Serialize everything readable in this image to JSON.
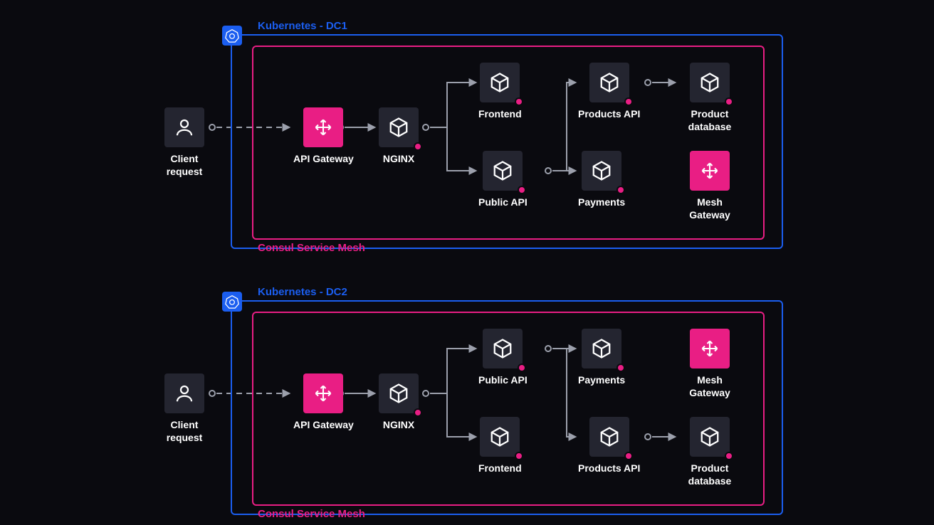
{
  "colors": {
    "background": "#0a0a0f",
    "cluster_border": "#1b5ef0",
    "mesh_border": "#e91e84",
    "node_bg": "#242530",
    "gateway_bg": "#e91e84",
    "text": "#ffffff"
  },
  "clients": [
    {
      "label": "Client request"
    },
    {
      "label": "Client request"
    }
  ],
  "clusters": [
    {
      "title": "Kubernetes - DC1",
      "mesh_title": "Consul Service Mesh",
      "nodes": {
        "api_gateway": {
          "label": "API Gateway",
          "icon": "move",
          "pink": true
        },
        "nginx": {
          "label": "NGINX",
          "icon": "cube",
          "dot": true
        },
        "frontend": {
          "label": "Frontend",
          "icon": "cube",
          "dot": true
        },
        "public_api": {
          "label": "Public API",
          "icon": "cube",
          "dot": true
        },
        "products_api": {
          "label": "Products API",
          "icon": "cube",
          "dot": true
        },
        "payments": {
          "label": "Payments",
          "icon": "cube",
          "dot": true
        },
        "product_db": {
          "label": "Product database",
          "icon": "cube",
          "dot": true
        },
        "mesh_gateway": {
          "label": "Mesh Gateway",
          "icon": "move",
          "pink": true
        }
      }
    },
    {
      "title": "Kubernetes - DC2",
      "mesh_title": "Consul Service Mesh",
      "nodes": {
        "api_gateway": {
          "label": "API Gateway",
          "icon": "move",
          "pink": true
        },
        "nginx": {
          "label": "NGINX",
          "icon": "cube",
          "dot": true
        },
        "public_api": {
          "label": "Public API",
          "icon": "cube",
          "dot": true
        },
        "frontend": {
          "label": "Frontend",
          "icon": "cube",
          "dot": true
        },
        "payments": {
          "label": "Payments",
          "icon": "cube",
          "dot": true
        },
        "products_api": {
          "label": "Products API",
          "icon": "cube",
          "dot": true
        },
        "mesh_gateway": {
          "label": "Mesh Gateway",
          "icon": "move",
          "pink": true
        },
        "product_db": {
          "label": "Product database",
          "icon": "cube",
          "dot": true
        }
      }
    }
  ],
  "edges_description": "Client → API Gateway (dashed). API Gateway → NGINX. NGINX → Frontend, NGINX → Public API. Frontend/PublicAPI → Products API & Payments. Products API → Product database."
}
